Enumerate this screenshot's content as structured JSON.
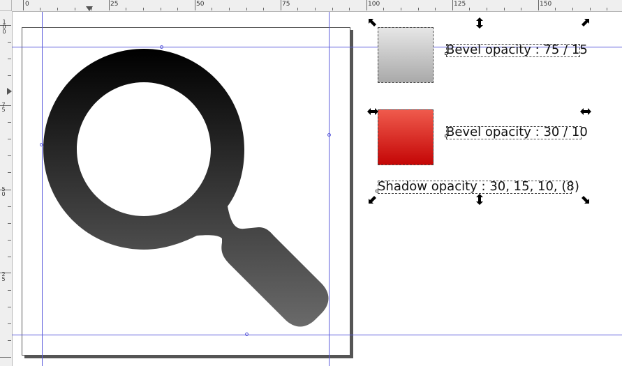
{
  "ruler_top": {
    "labels": [
      "0",
      "25",
      "50",
      "75",
      "100",
      "125",
      "150"
    ]
  },
  "ruler_left": {
    "labels": [
      "100",
      "75",
      "50",
      "25"
    ]
  },
  "objects": {
    "bevel_75": {
      "label": "Bevel opacity : 75 / 15"
    },
    "bevel_30": {
      "label": "Bevel opacity : 30 / 10"
    },
    "shadow": {
      "label": "Shadow opacity : 30, 15, 10, (8)"
    }
  },
  "colors": {
    "guide": "#5b5bdb",
    "magnifier_top": "#000000",
    "magnifier_bottom": "#6a6a6a",
    "swatch_grey_top": "#e6e6e6",
    "swatch_grey_bottom": "#a9a9a9",
    "swatch_red_top": "#ef5a4c",
    "swatch_red_bottom": "#c40606"
  },
  "icons": {
    "magnifier": "magnifying-glass-icon",
    "scale_handle": "diagonal-arrow-handle-icon",
    "stretch_handle_v": "vertical-arrow-handle-icon",
    "stretch_handle_h": "horizontal-arrow-handle-icon"
  }
}
